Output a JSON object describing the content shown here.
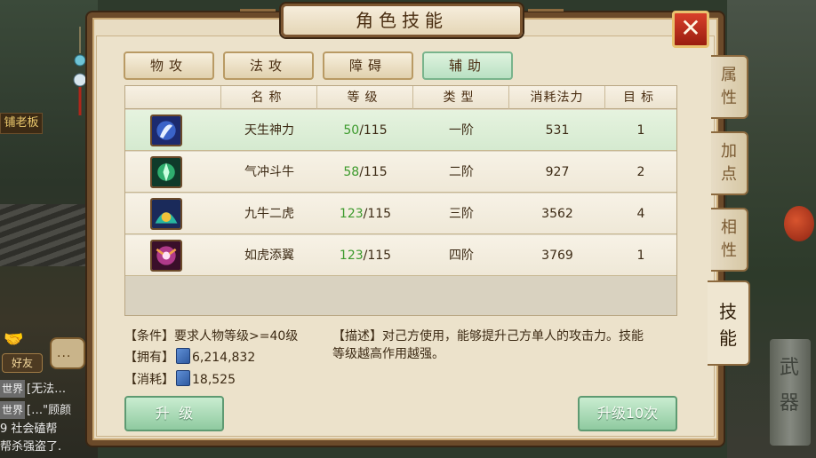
{
  "window": {
    "title": "角色技能",
    "close_symbol": "✕"
  },
  "category_tabs": [
    {
      "label": "物攻",
      "active": false
    },
    {
      "label": "法攻",
      "active": false
    },
    {
      "label": "障碍",
      "active": false
    },
    {
      "label": "辅助",
      "active": true
    }
  ],
  "table": {
    "headers": [
      "名称",
      "等级",
      "类型",
      "消耗法力",
      "目标"
    ],
    "rows": [
      {
        "icon": "skill-tiansheng-icon",
        "name": "天生神力",
        "level_cur": "50",
        "level_max": "/115",
        "type": "一阶",
        "mana": "531",
        "target": "1",
        "selected": true
      },
      {
        "icon": "skill-qichong-icon",
        "name": "气冲斗牛",
        "level_cur": "58",
        "level_max": "/115",
        "type": "二阶",
        "mana": "927",
        "target": "2",
        "selected": false
      },
      {
        "icon": "skill-jiuniu-icon",
        "name": "九牛二虎",
        "level_cur": "123",
        "level_max": "/115",
        "type": "三阶",
        "mana": "3562",
        "target": "4",
        "selected": false
      },
      {
        "icon": "skill-ruhu-icon",
        "name": "如虎添翼",
        "level_cur": "123",
        "level_max": "/115",
        "type": "四阶",
        "mana": "3769",
        "target": "1",
        "selected": false
      }
    ]
  },
  "info": {
    "condition": "【条件】要求人物等级>=40级",
    "owned_label": "【拥有】",
    "owned_value": "6,214,832",
    "cost_label": "【消耗】",
    "cost_value": "18,525",
    "description_line1": "【描述】对己方使用，能够提升己方单人的攻击力。技能",
    "description_line2": "等级越高作用越强。"
  },
  "buttons": {
    "upgrade": "升  级",
    "upgrade10": "升级10次"
  },
  "side_tabs": [
    {
      "label": "属\n性",
      "active": false
    },
    {
      "label": "加\n点",
      "active": false
    },
    {
      "label": "相\n性",
      "active": false
    },
    {
      "label": "技\n能",
      "active": true
    }
  ],
  "background": {
    "sign_text": "铺老板",
    "friend_button": "好友",
    "chat_lines": [
      {
        "tag": "世界",
        "text": "[无法…"
      },
      {
        "tag": "世界",
        "text": "[…\"顾颜"
      },
      {
        "tag": "",
        "text": "9  社会磕帮"
      },
      {
        "tag": "",
        "text": "帮杀强盗了."
      }
    ],
    "tablet_chars": [
      "武",
      "器"
    ]
  },
  "colors": {
    "panel_bg": "#e8dcc2",
    "frame": "#6b4a2a",
    "active_tab": "#b9e0c3",
    "level_green": "#3c9a2c",
    "close_red": "#c8321e",
    "button_green": "#8fcaa0"
  }
}
